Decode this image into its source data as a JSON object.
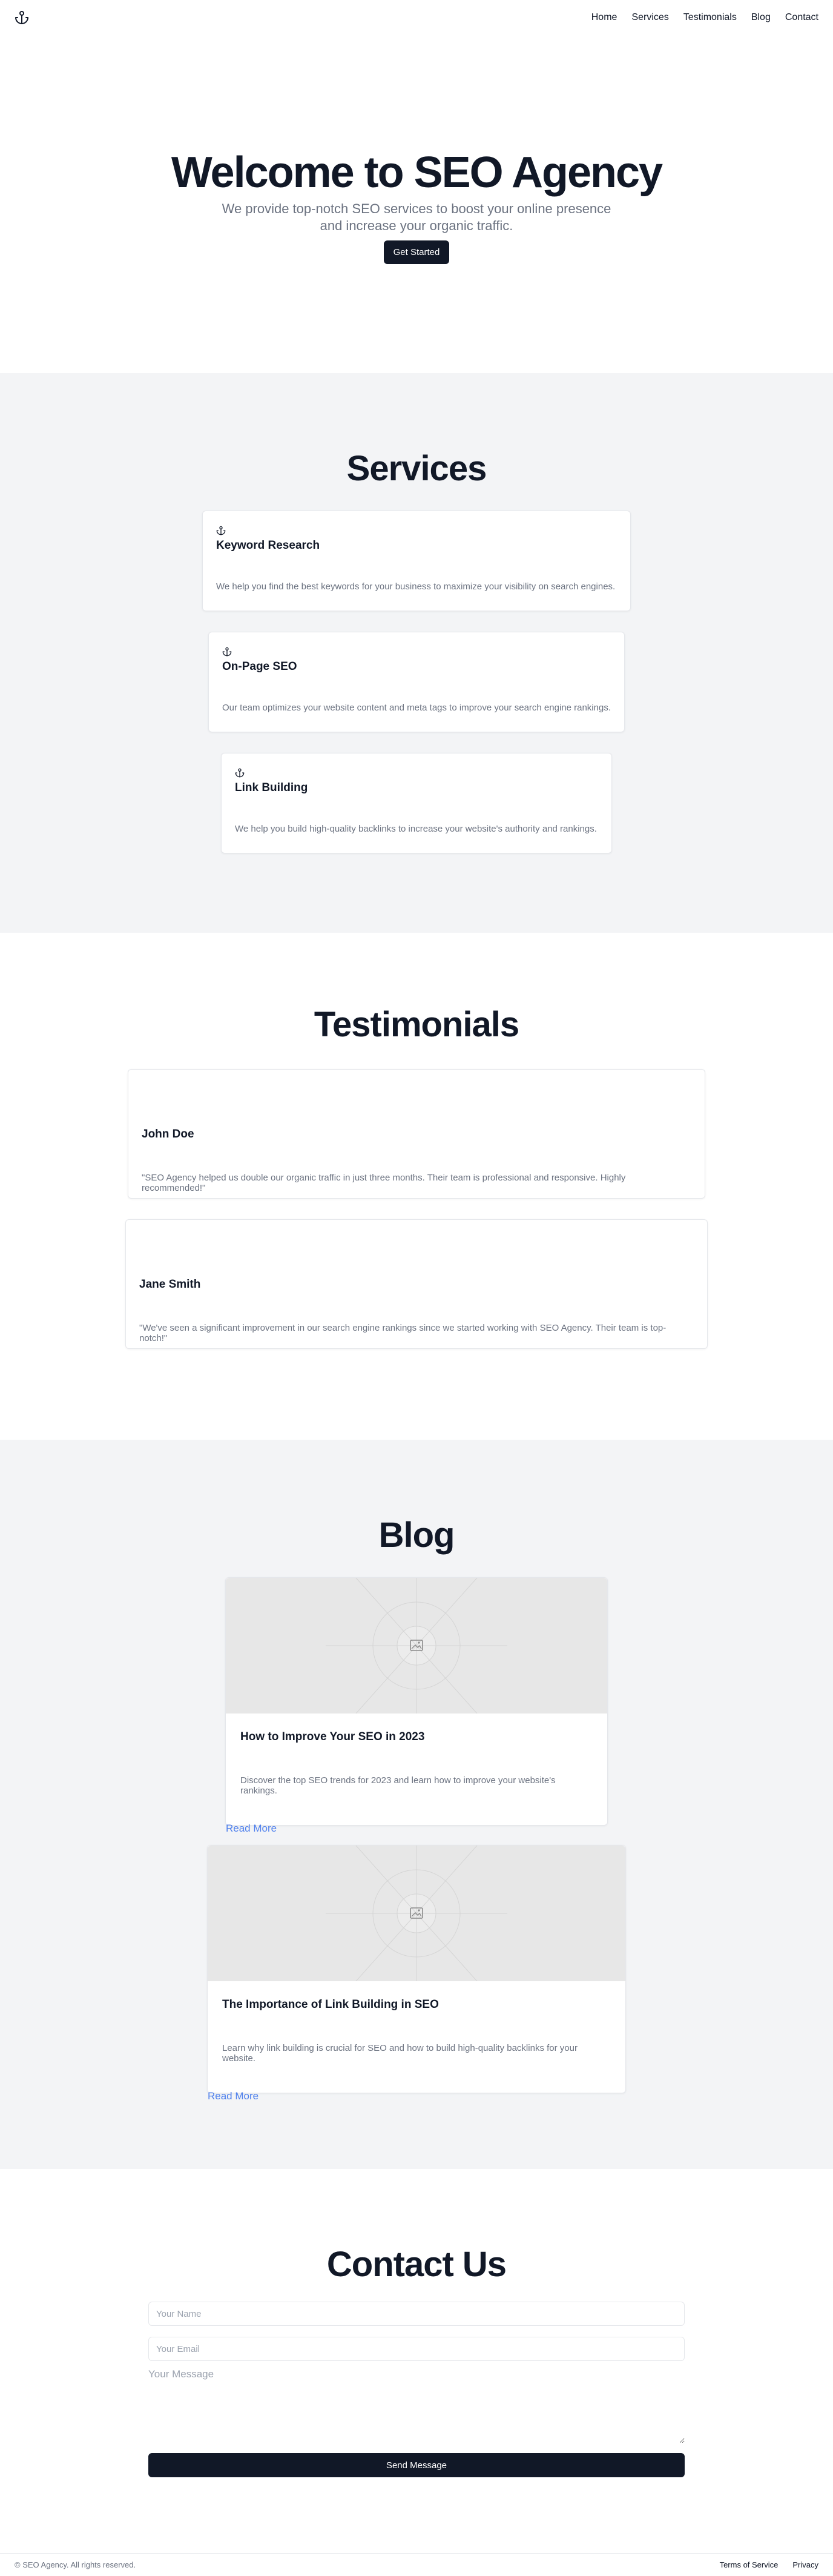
{
  "header": {
    "logo_icon": "anchor-icon",
    "nav": [
      {
        "label": "Home"
      },
      {
        "label": "Services"
      },
      {
        "label": "Testimonials"
      },
      {
        "label": "Blog"
      },
      {
        "label": "Contact"
      }
    ]
  },
  "hero": {
    "title": "Welcome to SEO Agency",
    "subtitle": "We provide top-notch SEO services to boost your online presence and increase your organic traffic.",
    "cta_label": "Get Started"
  },
  "services": {
    "title": "Services",
    "items": [
      {
        "icon": "anchor-icon",
        "title": "Keyword Research",
        "description": "We help you find the best keywords for your business to maximize your visibility on search engines."
      },
      {
        "icon": "anchor-icon",
        "title": "On-Page SEO",
        "description": "Our team optimizes your website content and meta tags to improve your search engine rankings."
      },
      {
        "icon": "anchor-icon",
        "title": "Link Building",
        "description": "We help you build high-quality backlinks to increase your website's authority and rankings."
      }
    ]
  },
  "testimonials": {
    "title": "Testimonials",
    "items": [
      {
        "name": "John Doe",
        "quote": "\"SEO Agency helped us double our organic traffic in just three months. Their team is professional and responsive. Highly recommended!\""
      },
      {
        "name": "Jane Smith",
        "quote": "\"We've seen a significant improvement in our search engine rankings since we started working with SEO Agency. Their team is top-notch!\""
      }
    ]
  },
  "blog": {
    "title": "Blog",
    "posts": [
      {
        "image_icon": "image-placeholder-icon",
        "title": "How to Improve Your SEO in 2023",
        "excerpt": "Discover the top SEO trends for 2023 and learn how to improve your website's rankings.",
        "link_label": "Read More"
      },
      {
        "image_icon": "image-placeholder-icon",
        "title": "The Importance of Link Building in SEO",
        "excerpt": "Learn why link building is crucial for SEO and how to build high-quality backlinks for your website.",
        "link_label": "Read More"
      }
    ]
  },
  "contact": {
    "title": "Contact Us",
    "name_placeholder": "Your Name",
    "email_placeholder": "Your Email",
    "message_placeholder": "Your Message",
    "submit_label": "Send Message"
  },
  "footer": {
    "copyright": "© SEO Agency. All rights reserved.",
    "links": [
      {
        "label": "Terms of Service"
      },
      {
        "label": "Privacy"
      }
    ]
  },
  "colors": {
    "primary": "#111827",
    "muted_text": "#6b7280",
    "section_bg": "#f3f4f6",
    "link": "#2563eb"
  }
}
